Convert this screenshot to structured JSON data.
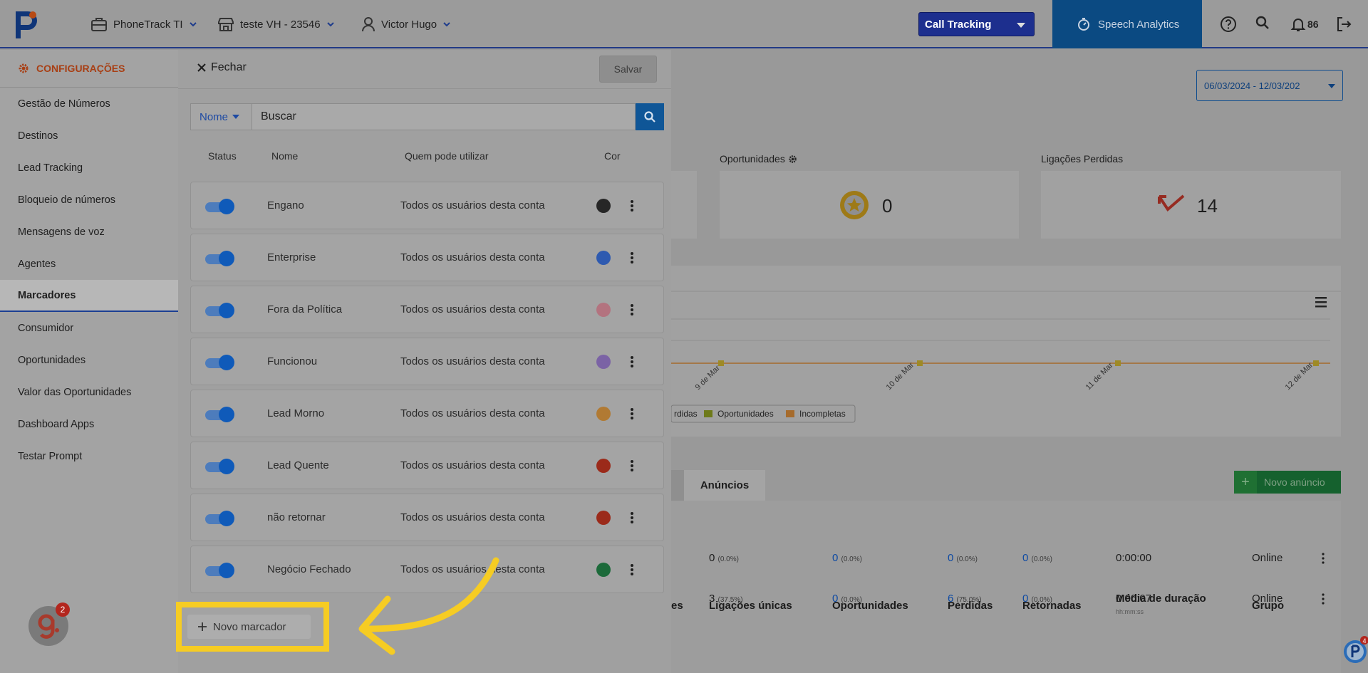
{
  "topbar": {
    "account": "PhoneTrack TI",
    "store": "teste VH - 23546",
    "user": "Victor Hugo",
    "product_select": "Call Tracking",
    "speech_analytics": "Speech Analytics",
    "notifications_count": "86"
  },
  "sidebar": {
    "section": "CONFIGURAÇÕES",
    "items": [
      {
        "label": "Gestão de Números"
      },
      {
        "label": "Destinos"
      },
      {
        "label": "Lead Tracking"
      },
      {
        "label": "Bloqueio de números"
      },
      {
        "label": "Mensagens de voz"
      },
      {
        "label": "Agentes"
      },
      {
        "label": "Marcadores",
        "active": true
      },
      {
        "label": "Consumidor"
      },
      {
        "label": "Oportunidades"
      },
      {
        "label": "Valor das Oportunidades"
      },
      {
        "label": "Dashboard Apps"
      },
      {
        "label": "Testar Prompt"
      }
    ]
  },
  "panel": {
    "close_label": "Fechar",
    "save_label": "Salvar",
    "filter_label": "Nome",
    "search_value": "Buscar",
    "columns": {
      "status": "Status",
      "name": "Nome",
      "who": "Quem pode utilizar",
      "color": "Cor"
    },
    "rows": [
      {
        "name": "Engano",
        "who": "Todos os usuários desta conta",
        "color": "#262626",
        "enabled": true
      },
      {
        "name": "Enterprise",
        "who": "Todos os usuários desta conta",
        "color": "#2e5ab0",
        "enabled": true
      },
      {
        "name": "Fora da Política",
        "who": "Todos os usuários desta conta",
        "color": "#b3737f",
        "enabled": true
      },
      {
        "name": "Funcionou",
        "who": "Todos os usuários desta conta",
        "color": "#7b63a5",
        "enabled": true
      },
      {
        "name": "Lead Morno",
        "who": "Todos os usuários desta conta",
        "color": "#b17a33",
        "enabled": true
      },
      {
        "name": "Lead Quente",
        "who": "Todos os usuários desta conta",
        "color": "#9b2a1a",
        "enabled": true
      },
      {
        "name": "não retornar",
        "who": "Todos os usuários desta conta",
        "color": "#9b2a1a",
        "enabled": true
      },
      {
        "name": "Negócio Fechado",
        "who": "Todos os usuários desta conta",
        "color": "#1c6a3a",
        "enabled": true
      }
    ],
    "new_marker_label": "Novo marcador"
  },
  "dashboard": {
    "date_range": "06/03/2024 - 12/03/202",
    "kpis": [
      {
        "label": "Oportunidades",
        "value": "0"
      },
      {
        "label": "Ligações Perdidas",
        "value": "14"
      }
    ],
    "chart_axis": [
      "9 de Mar",
      "10 de Mar",
      "11 de Mar",
      "12 de Mar"
    ],
    "legend": [
      "rdidas",
      "Oportunidades",
      "Incompletas"
    ],
    "tab_active": "Anúncios",
    "new_ad_label": "Novo anúncio",
    "table_headers": [
      "es",
      "Ligações únicas",
      "Oportunidades",
      "Perdidas",
      "Retornadas",
      "Média de duração",
      "Grupo"
    ],
    "duration_hint": "hh:mm:ss",
    "table_rows": [
      {
        "unique": "0",
        "unique_pct": "(0.0%)",
        "opp": "0",
        "opp_pct": "(0.0%)",
        "lost": "0",
        "lost_pct": "(0.0%)",
        "ret": "0",
        "ret_pct": "(0.0%)",
        "avg": "0:00:00",
        "group": "Online"
      },
      {
        "unique": "3",
        "unique_pct": "(37.5%)",
        "opp": "0",
        "opp_pct": "(0.0%)",
        "lost": "6",
        "lost_pct": "(75.0%)",
        "ret": "0",
        "ret_pct": "(0.0%)",
        "avg": "0:00:07",
        "group": "Online"
      }
    ]
  },
  "widgets": {
    "g_badge": "2",
    "helper_badge": "4"
  },
  "colors": {
    "accent_blue": "#0b4a82",
    "highlight_yellow": "#f6cc23",
    "brand_orange": "#a83f14"
  }
}
